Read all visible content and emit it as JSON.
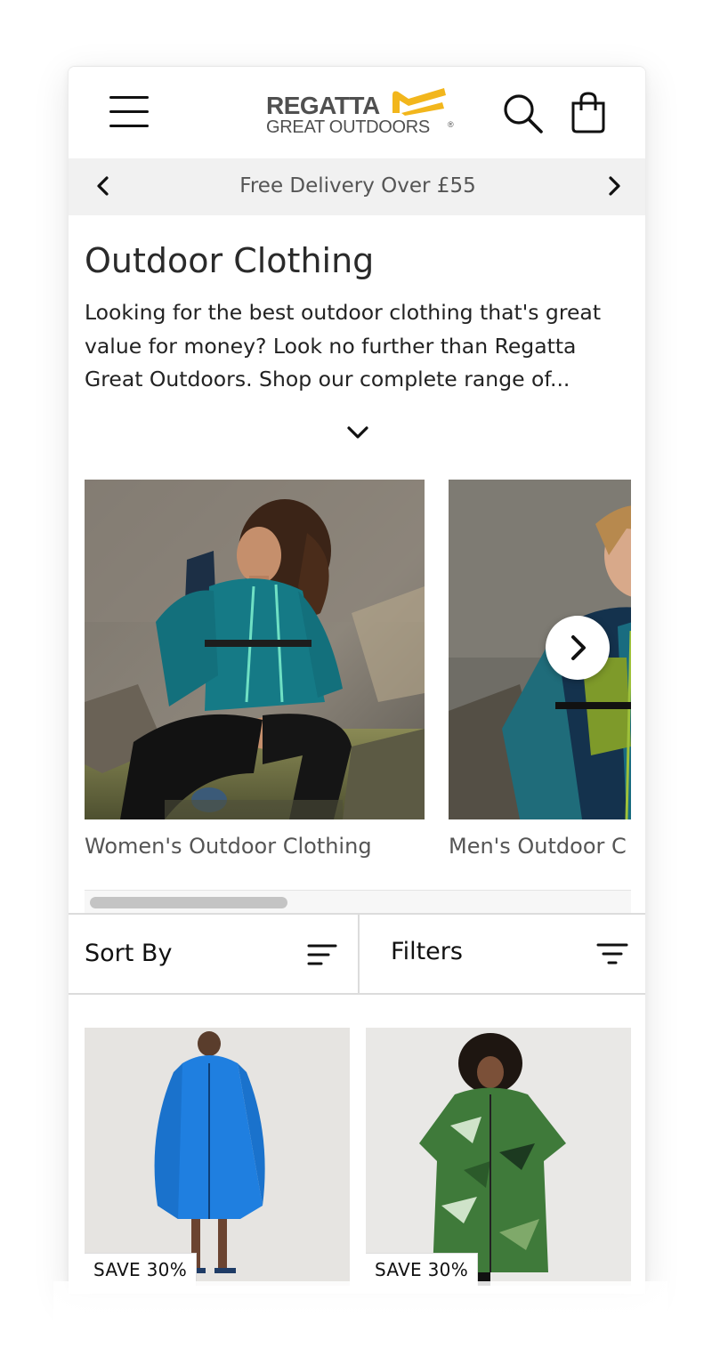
{
  "header": {
    "logo_line1": "REGATTA",
    "logo_line2": "GREAT OUTDOORS",
    "logo_mark_symbol": "®",
    "brand_accent": "#F2B61C"
  },
  "promo": {
    "text": "Free Delivery Over £55"
  },
  "intro": {
    "title": "Outdoor Clothing",
    "body": "Looking for the best outdoor clothing that's great value for money? Look no further than Regatta Great Outdoors. Shop our complete range of..."
  },
  "categories": [
    {
      "label": "Women's Outdoor Clothing"
    },
    {
      "label": "Men's Outdoor C"
    }
  ],
  "toolbar": {
    "sort_label": "Sort By",
    "filters_label": "Filters"
  },
  "products": [
    {
      "badge": "SAVE 30%",
      "robe_color": "#1f7fe0"
    },
    {
      "badge": "SAVE 30%",
      "robe_color": "#3f7a3a"
    }
  ]
}
